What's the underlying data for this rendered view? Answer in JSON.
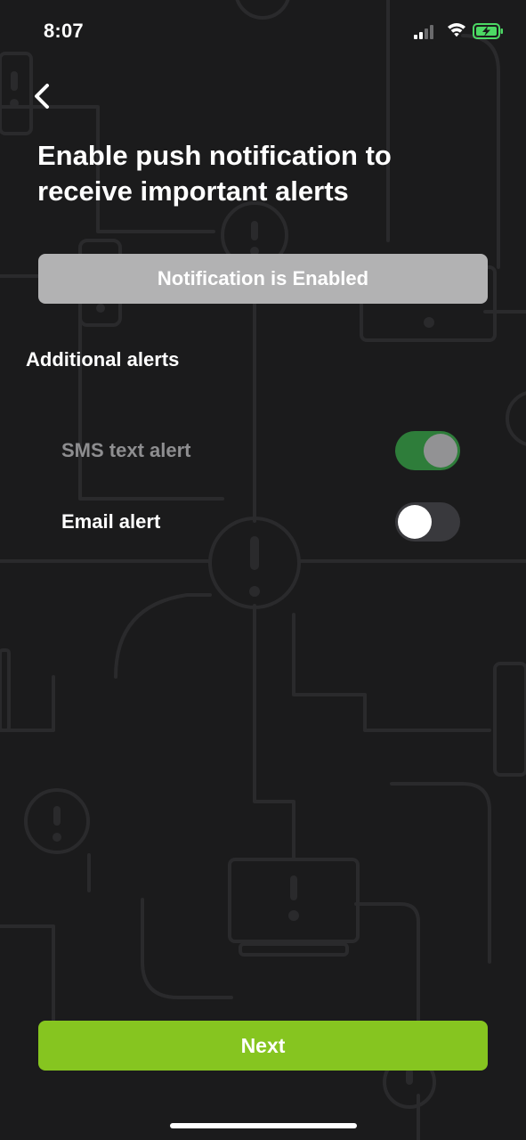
{
  "status_bar": {
    "time": "8:07",
    "icons": [
      "cellular-signal-icon",
      "wifi-icon",
      "battery-charging-icon"
    ],
    "battery_color": "#4cd964"
  },
  "header": {
    "back_icon": "chevron-left-icon",
    "title": "Enable push notification to receive important alerts"
  },
  "notification_button": {
    "label": "Notification is Enabled",
    "color": "#b2b2b3"
  },
  "additional_alerts": {
    "title": "Additional alerts",
    "items": [
      {
        "label": "SMS text alert",
        "enabled": true
      },
      {
        "label": "Email alert",
        "enabled": false
      }
    ]
  },
  "footer": {
    "next_label": "Next",
    "accent_color": "#86c520"
  }
}
